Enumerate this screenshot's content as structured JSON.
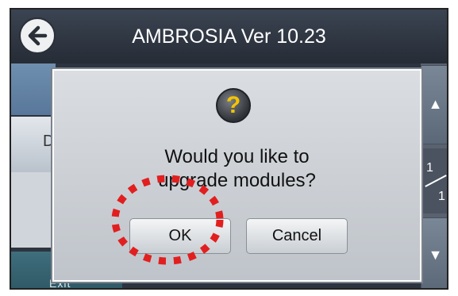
{
  "titlebar": {
    "title": "AMBROSIA Ver 10.23",
    "back_icon": "back-arrow-icon"
  },
  "background": {
    "left_button_fragment": "D",
    "bottom_button_fragment": "Exit",
    "scroll_up_icon": "triangle-up-icon",
    "scroll_down_icon": "triangle-down-icon",
    "page_current": "1",
    "page_total": "1"
  },
  "dialog": {
    "icon": "question-icon",
    "icon_glyph": "?",
    "message_line1": "Would you like to",
    "message_line2": "upgrade modules?",
    "ok_label": "OK",
    "cancel_label": "Cancel"
  },
  "annotation": {
    "highlight_color": "#e21f1f",
    "style": "dashed-circle"
  }
}
